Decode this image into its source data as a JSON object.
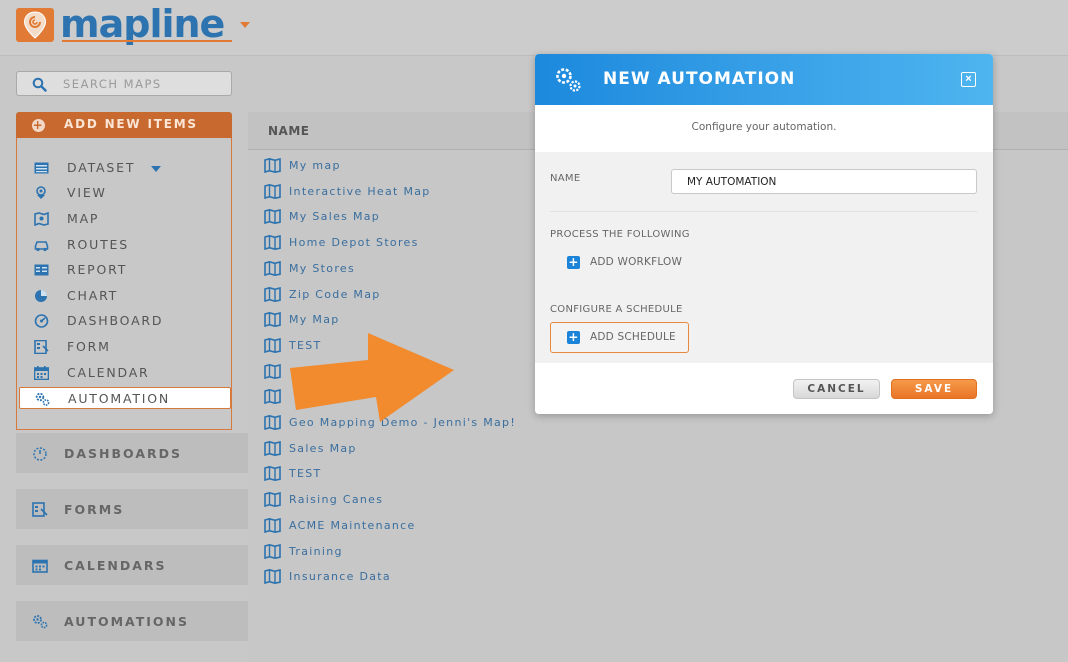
{
  "app": {
    "logo_text": "mapline",
    "brand_orange": "#e07a34",
    "brand_blue": "#2c73b0"
  },
  "sidebar": {
    "search_placeholder": "SEARCH MAPS",
    "add_new_label": "ADD NEW ITEMS",
    "add_menu": [
      {
        "label": "DATASET",
        "icon": "dataset-icon"
      },
      {
        "label": "VIEW",
        "icon": "view-icon"
      },
      {
        "label": "MAP",
        "icon": "map-icon"
      },
      {
        "label": "ROUTES",
        "icon": "routes-icon"
      },
      {
        "label": "REPORT",
        "icon": "report-icon"
      },
      {
        "label": "CHART",
        "icon": "chart-icon"
      },
      {
        "label": "DASHBOARD",
        "icon": "dashboard-icon"
      },
      {
        "label": "FORM",
        "icon": "form-icon"
      },
      {
        "label": "CALENDAR",
        "icon": "calendar-icon"
      },
      {
        "label": "AUTOMATION",
        "icon": "automation-icon",
        "active": true
      }
    ],
    "sections": [
      {
        "label": "DASHBOARDS",
        "icon": "dashboards-icon"
      },
      {
        "label": "FORMS",
        "icon": "forms-icon"
      },
      {
        "label": "CALENDARS",
        "icon": "calendars-icon"
      },
      {
        "label": "AUTOMATIONS",
        "icon": "automations-icon"
      }
    ]
  },
  "list": {
    "column_header": "NAME",
    "items": [
      "My map",
      "Interactive Heat Map",
      "My Sales Map",
      "Home Depot Stores",
      "My Stores",
      "Zip Code Map",
      "My Map",
      "TEST",
      "",
      "",
      "Geo Mapping Demo - Jenni's Map!",
      "Sales Map",
      "TEST",
      "Raising Canes",
      "ACME Maintenance",
      "Training",
      "Insurance Data"
    ]
  },
  "modal": {
    "title": "NEW AUTOMATION",
    "subtitle": "Configure your automation.",
    "name_label": "NAME",
    "name_value": "MY AUTOMATION",
    "process_label": "PROCESS THE FOLLOWING",
    "add_workflow": "ADD WORKFLOW",
    "schedule_label": "CONFIGURE A SCHEDULE",
    "add_schedule": "ADD SCHEDULE",
    "cancel": "CANCEL",
    "save": "SAVE",
    "header_color": "#1d89dd",
    "save_color": "#ea7427"
  }
}
